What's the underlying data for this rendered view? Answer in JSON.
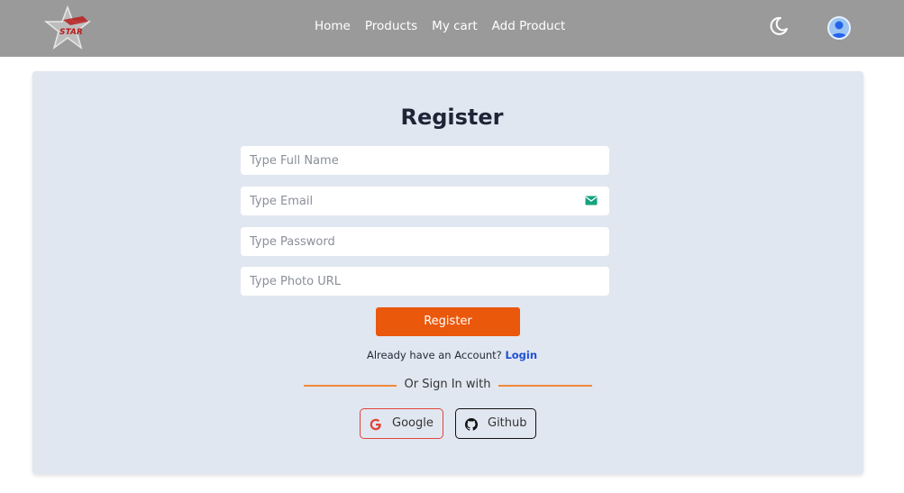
{
  "navbar": {
    "logo_text": "STAR",
    "links": [
      "Home",
      "Products",
      "My cart",
      "Add Product"
    ],
    "theme_icon": "moon-icon",
    "avatar_icon": "user-avatar-icon"
  },
  "form": {
    "title": "Register",
    "name_placeholder": "Type Full Name",
    "email_placeholder": "Type Email",
    "password_placeholder": "Type Password",
    "photo_placeholder": "Type Photo URL",
    "submit_label": "Register",
    "already_text": "Already have an Account?",
    "login_label": "Login",
    "or_text": "Or Sign In with",
    "google_label": "Google",
    "github_label": "Github"
  },
  "colors": {
    "navbar": "#9a9a9a",
    "card": "#e1e7f0",
    "accent": "#ea580c",
    "link": "#1d4ed8"
  }
}
